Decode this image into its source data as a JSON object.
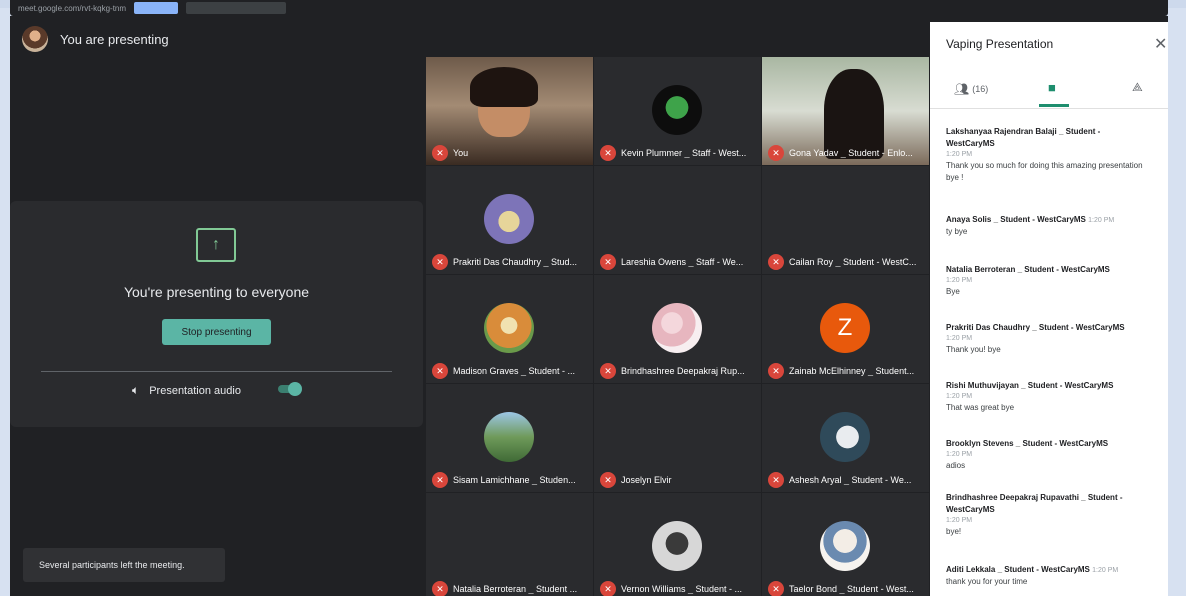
{
  "browser": {
    "url": "meet.google.com/rvt-kqkg-tnm"
  },
  "presenting": {
    "header": "You are presenting",
    "card_text": "You're presenting to everyone",
    "stop_button": "Stop presenting",
    "audio_label": "Presentation audio",
    "audio_on": true
  },
  "toast": "Several participants left the meeting.",
  "tiles": [
    {
      "name": "You"
    },
    {
      "name": "Kevin Plummer _ Staff - West..."
    },
    {
      "name": "Gona Yadav _ Student - Enlo..."
    },
    {
      "name": "Prakriti Das Chaudhry _ Stud..."
    },
    {
      "name": "Lareshia Owens _ Staff - We..."
    },
    {
      "name": "Cailan Roy _ Student - WestC..."
    },
    {
      "name": "Madison Graves _ Student - ..."
    },
    {
      "name": "Brindhashree Deepakraj Rup..."
    },
    {
      "name": "Zainab McElhinney _ Student...",
      "letter": "Z"
    },
    {
      "name": "Sisam Lamichhane _ Studen..."
    },
    {
      "name": "Joselyn Elvir"
    },
    {
      "name": "Ashesh Aryal _ Student - We..."
    },
    {
      "name": "Natalia Berroteran _ Student ..."
    },
    {
      "name": "Vernon Williams _ Student - ..."
    },
    {
      "name": "Taelor Bond _ Student - West..."
    }
  ],
  "side": {
    "title": "Vaping Presentation",
    "people_count": "(16)",
    "messages": [
      {
        "sender": "Lakshanyaa Rajendran Balaji _ Student - WestCaryMS",
        "time": "1:20 PM",
        "text": "Thank you so much for doing this amazing presentation bye !"
      },
      {
        "sender": "Anaya Solis _ Student - WestCaryMS",
        "time": "1:20 PM",
        "text": "ty bye"
      },
      {
        "sender": "Natalia Berroteran _ Student - WestCaryMS",
        "time": "1:20 PM",
        "text": "Bye"
      },
      {
        "sender": "Prakriti Das Chaudhry _ Student - WestCaryMS",
        "time": "1:20 PM",
        "text": "Thank you! bye"
      },
      {
        "sender": "Rishi Muthuvijayan _ Student - WestCaryMS",
        "time": "1:20 PM",
        "text": "That was great bye"
      },
      {
        "sender": "Brooklyn Stevens _ Student - WestCaryMS",
        "time": "1:20 PM",
        "text": "adios"
      },
      {
        "sender": "Brindhashree Deepakraj Rupavathi _ Student - WestCaryMS",
        "time": "1:20 PM",
        "text": "bye!"
      },
      {
        "sender": "Aditi Lekkala _ Student - WestCaryMS",
        "time": "1:20 PM",
        "text": "thank you for your time"
      }
    ]
  },
  "colors": {
    "accent": "#5bb5a5",
    "chat_accent": "#1e8e6e",
    "mic_off": "#d9463b",
    "letter_avatar": "#e8590c"
  }
}
